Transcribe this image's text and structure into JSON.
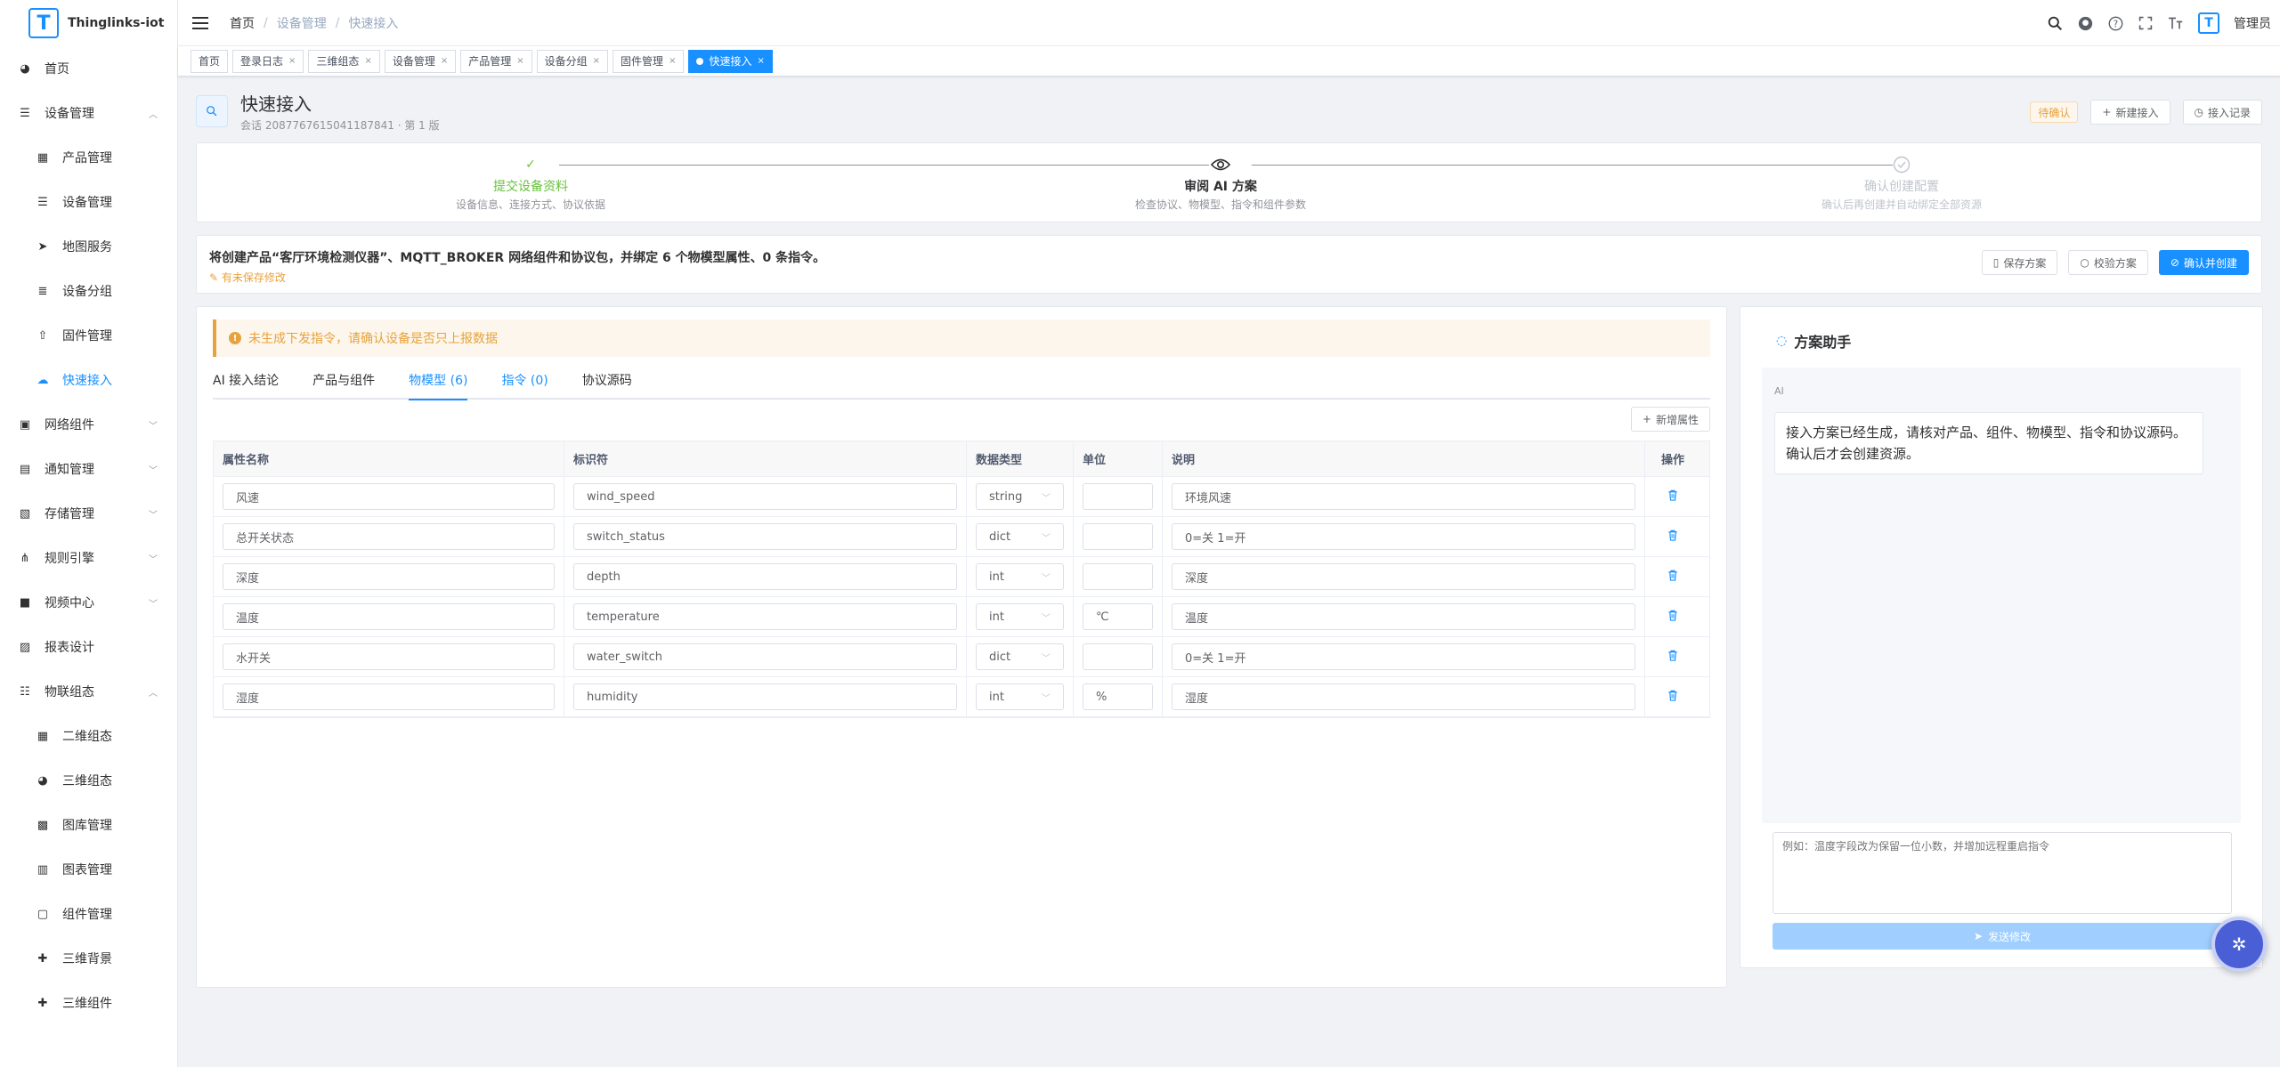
{
  "app": {
    "name": "Thinglinks-iot",
    "logo_letter": "T"
  },
  "sidebar": {
    "items": [
      {
        "label": "首页",
        "icon": "dashboard-icon",
        "glyph": "◕",
        "type": "top"
      },
      {
        "label": "设备管理",
        "icon": "server-icon",
        "glyph": "☰",
        "type": "group",
        "expanded": true
      },
      {
        "label": "产品管理",
        "icon": "grid-icon",
        "glyph": "▦",
        "type": "sub"
      },
      {
        "label": "设备管理",
        "icon": "server-icon",
        "glyph": "☰",
        "type": "sub"
      },
      {
        "label": "地图服务",
        "icon": "send-icon",
        "glyph": "➤",
        "type": "sub"
      },
      {
        "label": "设备分组",
        "icon": "list-icon",
        "glyph": "≣",
        "type": "sub"
      },
      {
        "label": "固件管理",
        "icon": "upload-icon",
        "glyph": "⇧",
        "type": "sub"
      },
      {
        "label": "快速接入",
        "icon": "cloud-icon",
        "glyph": "☁",
        "type": "sub",
        "active": true
      },
      {
        "label": "网络组件",
        "icon": "network-icon",
        "glyph": "▣",
        "type": "group"
      },
      {
        "label": "通知管理",
        "icon": "message-icon",
        "glyph": "▤",
        "type": "group"
      },
      {
        "label": "存储管理",
        "icon": "storage-icon",
        "glyph": "▧",
        "type": "group"
      },
      {
        "label": "规则引擎",
        "icon": "tree-icon",
        "glyph": "⋔",
        "type": "group"
      },
      {
        "label": "视频中心",
        "icon": "video-icon",
        "glyph": "■",
        "type": "group"
      },
      {
        "label": "报表设计",
        "icon": "report-icon",
        "glyph": "▨",
        "type": "top"
      },
      {
        "label": "物联组态",
        "icon": "layout-icon",
        "glyph": "☷",
        "type": "group",
        "expanded": true
      },
      {
        "label": "二维组态",
        "icon": "grid-icon",
        "glyph": "▦",
        "type": "sub"
      },
      {
        "label": "三维组态",
        "icon": "dashboard-icon",
        "glyph": "◕",
        "type": "sub"
      },
      {
        "label": "图库管理",
        "icon": "image-icon",
        "glyph": "▩",
        "type": "sub"
      },
      {
        "label": "图表管理",
        "icon": "bar-chart-icon",
        "glyph": "▥",
        "type": "sub"
      },
      {
        "label": "组件管理",
        "icon": "component-icon",
        "glyph": "▢",
        "type": "sub"
      },
      {
        "label": "三维背景",
        "icon": "puzzle-icon",
        "glyph": "✚",
        "type": "sub"
      },
      {
        "label": "三维组件",
        "icon": "puzzle-icon",
        "glyph": "✚",
        "type": "sub"
      }
    ]
  },
  "topbar": {
    "breadcrumb": [
      "首页",
      "设备管理",
      "快速接入"
    ],
    "username": "管理员"
  },
  "tags": [
    {
      "label": "首页",
      "closable": false
    },
    {
      "label": "登录日志",
      "closable": true
    },
    {
      "label": "三维组态",
      "closable": true
    },
    {
      "label": "设备管理",
      "closable": true
    },
    {
      "label": "产品管理",
      "closable": true
    },
    {
      "label": "设备分组",
      "closable": true
    },
    {
      "label": "固件管理",
      "closable": true
    },
    {
      "label": "快速接入",
      "closable": true,
      "active": true
    }
  ],
  "page": {
    "title": "快速接入",
    "subtitle": "会话 2087767615041187841 · 第 1 版",
    "status_badge": "待确认",
    "new_access_label": "新建接入",
    "access_record_label": "接入记录"
  },
  "steps": [
    {
      "title": "提交设备资料",
      "desc": "设备信息、连接方式、协议依据",
      "state": "done",
      "glyph": "✓"
    },
    {
      "title": "审阅 AI 方案",
      "desc": "检查协议、物模型、指令和组件参数",
      "state": "current",
      "glyph": "◉"
    },
    {
      "title": "确认创建配置",
      "desc": "确认后再创建并自动绑定全部资源",
      "state": "wait",
      "glyph": "✓"
    }
  ],
  "summary": {
    "text": "将创建产品“客厅环境检测仪器”、MQTT_BROKER 网络组件和协议包，并绑定 6 个物模型属性、0 条指令。",
    "unsaved": "有未保存修改",
    "save_label": "保存方案",
    "validate_label": "校验方案",
    "confirm_label": "确认并创建"
  },
  "alert": {
    "text": "未生成下发指令，请确认设备是否只上报数据"
  },
  "tabs": [
    {
      "label": "AI 接入结论"
    },
    {
      "label": "产品与组件"
    },
    {
      "label": "物模型 (6)",
      "active": true
    },
    {
      "label": "指令 (0)",
      "blue": true
    },
    {
      "label": "协议源码"
    }
  ],
  "add_attr_label": "新增属性",
  "table": {
    "columns": [
      "属性名称",
      "标识符",
      "数据类型",
      "单位",
      "说明",
      "操作"
    ],
    "rows": [
      {
        "name": "风速",
        "identifier": "wind_speed",
        "type": "string",
        "unit": "",
        "desc": "环境风速"
      },
      {
        "name": "总开关状态",
        "identifier": "switch_status",
        "type": "dict",
        "unit": "",
        "desc": "0=关 1=开"
      },
      {
        "name": "深度",
        "identifier": "depth",
        "type": "int",
        "unit": "",
        "desc": "深度"
      },
      {
        "name": "温度",
        "identifier": "temperature",
        "type": "int",
        "unit": "℃",
        "desc": "温度"
      },
      {
        "name": "水开关",
        "identifier": "water_switch",
        "type": "dict",
        "unit": "",
        "desc": "0=关 1=开"
      },
      {
        "name": "湿度",
        "identifier": "humidity",
        "type": "int",
        "unit": "%",
        "desc": "湿度"
      }
    ]
  },
  "assistant": {
    "title": "方案助手",
    "ai_label": "AI",
    "message": "接入方案已经生成，请核对产品、组件、物模型、指令和协议源码。确认后才会创建资源。",
    "input_placeholder": "例如：温度字段改为保留一位小数，并增加远程重启指令",
    "send_label": "发送修改"
  },
  "colors": {
    "primary": "#1890ff",
    "success": "#67c23a",
    "warning": "#e6a23c"
  }
}
